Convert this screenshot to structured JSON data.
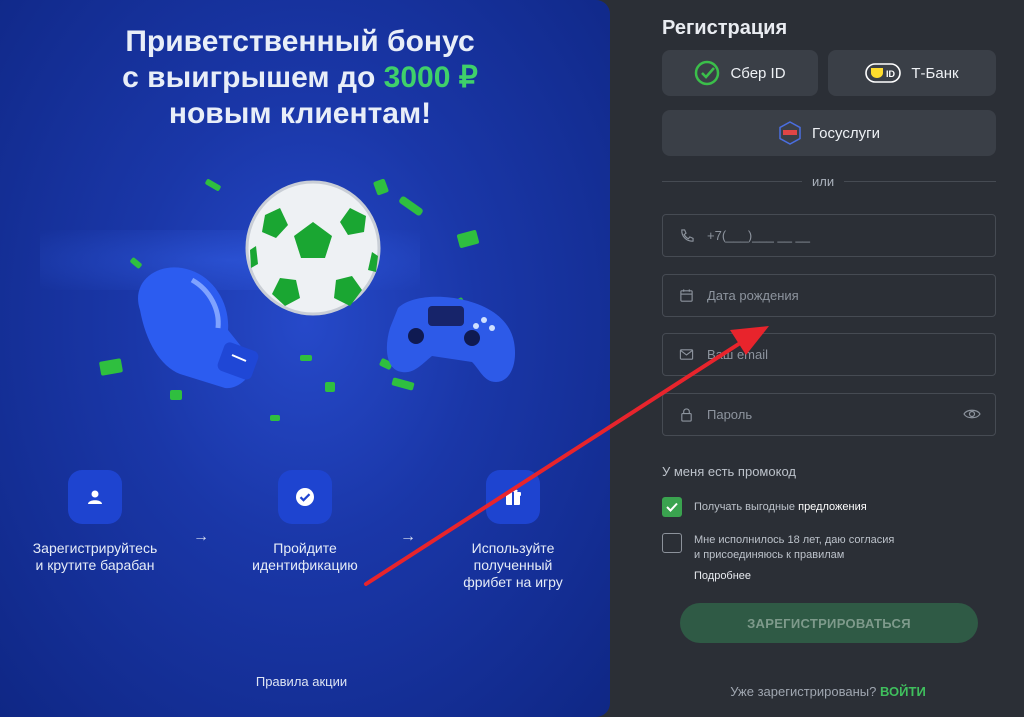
{
  "promo": {
    "title_line1": "Приветственный бонус",
    "title_line2_prefix": "с выигрышем до ",
    "title_line2_accent": "3000 ₽",
    "title_line3": "новым клиентам!",
    "steps": [
      {
        "label_line1": "Зарегистрируйтесь",
        "label_line2": "и крутите барабан",
        "label_line3": "",
        "icon": "user-icon"
      },
      {
        "label_line1": "Пройдите",
        "label_line2": "идентификацию",
        "label_line3": "",
        "icon": "check-badge-icon"
      },
      {
        "label_line1": "Используйте",
        "label_line2": "полученный",
        "label_line3": "фрибет на игру",
        "icon": "gift-icon"
      }
    ],
    "arrow_glyph": "→",
    "rules_link": "Правила акции",
    "accent_color": "#3fd06a"
  },
  "registration": {
    "title": "Регистрация",
    "sber_label": "Сбер ID",
    "tbank_label": "Т-Банк",
    "gosuslugi_label": "Госуслуги",
    "divider_text": "или",
    "phone_placeholder": "+7(___)___ __ __",
    "birth_placeholder": "Дата рождения",
    "email_placeholder": "Ваш email",
    "password_placeholder": "Пароль",
    "promo_code_toggle": "У меня есть промокод",
    "offers_text": "Получать выгодные ",
    "offers_highlight": "предложения",
    "offers_checked": true,
    "age_text_line1": "Мне исполнилось 18 лет, даю согласия",
    "age_text_line2": "и присоединяюсь к правилам",
    "age_checked": false,
    "more_link": "Подробнее",
    "submit_label": "ЗАРЕГИСТРИРОВАТЬСЯ",
    "already_text": "Уже зарегистрированы? ",
    "login_link": "ВОЙТИ",
    "login_color": "#3fbf5d"
  }
}
